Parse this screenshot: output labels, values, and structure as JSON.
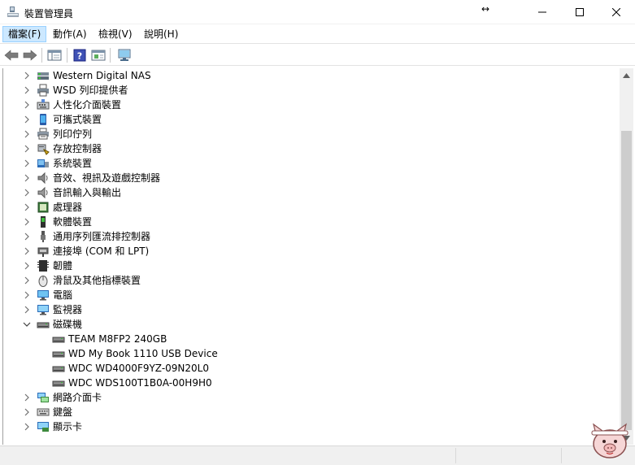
{
  "window": {
    "title": "裝置管理員",
    "resize_indicator": "↔"
  },
  "menu": {
    "items": [
      {
        "label": "檔案(F)"
      },
      {
        "label": "動作(A)"
      },
      {
        "label": "檢視(V)"
      },
      {
        "label": "說明(H)"
      }
    ]
  },
  "tree": {
    "categories": [
      {
        "label": "Western Digital NAS",
        "icon": "nas-icon",
        "expanded": false
      },
      {
        "label": "WSD 列印提供者",
        "icon": "printer-icon",
        "expanded": false
      },
      {
        "label": "人性化介面裝置",
        "icon": "hid-icon",
        "expanded": false
      },
      {
        "label": "可攜式裝置",
        "icon": "portable-device-icon",
        "expanded": false
      },
      {
        "label": "列印佇列",
        "icon": "print-queue-icon",
        "expanded": false
      },
      {
        "label": "存放控制器",
        "icon": "storage-controller-icon",
        "expanded": false
      },
      {
        "label": "系統裝置",
        "icon": "system-device-icon",
        "expanded": false
      },
      {
        "label": "音效、視訊及遊戲控制器",
        "icon": "speaker-icon",
        "expanded": false
      },
      {
        "label": "音訊輸入與輸出",
        "icon": "audio-io-icon",
        "expanded": false
      },
      {
        "label": "處理器",
        "icon": "processor-icon",
        "expanded": false
      },
      {
        "label": "軟體裝置",
        "icon": "software-device-icon",
        "expanded": false
      },
      {
        "label": "通用序列匯流排控制器",
        "icon": "usb-icon",
        "expanded": false
      },
      {
        "label": "連接埠 (COM 和 LPT)",
        "icon": "port-icon",
        "expanded": false
      },
      {
        "label": "韌體",
        "icon": "firmware-icon",
        "expanded": false
      },
      {
        "label": "滑鼠及其他指標裝置",
        "icon": "mouse-icon",
        "expanded": false
      },
      {
        "label": "電腦",
        "icon": "computer-icon",
        "expanded": false
      },
      {
        "label": "監視器",
        "icon": "monitor-icon",
        "expanded": false
      },
      {
        "label": "磁碟機",
        "icon": "disk-drive-icon",
        "expanded": true
      },
      {
        "label": "網路介面卡",
        "icon": "network-adapter-icon",
        "expanded": false
      },
      {
        "label": "鍵盤",
        "icon": "keyboard-icon",
        "expanded": false
      },
      {
        "label": "顯示卡",
        "icon": "display-adapter-icon",
        "expanded": false
      }
    ],
    "disk_drives": [
      {
        "label": "TEAM M8FP2 240GB"
      },
      {
        "label": "WD My Book 1110 USB Device"
      },
      {
        "label": "WDC WD4000F9YZ-09N20L0"
      },
      {
        "label": "WDC WDS100T1B0A-00H9H0"
      }
    ]
  },
  "colors": {
    "menu_active_bg": "#cce8ff",
    "menu_active_border": "#99d1ff",
    "scroll_track": "#f0f0f0",
    "scroll_thumb": "#cdcdcd"
  }
}
